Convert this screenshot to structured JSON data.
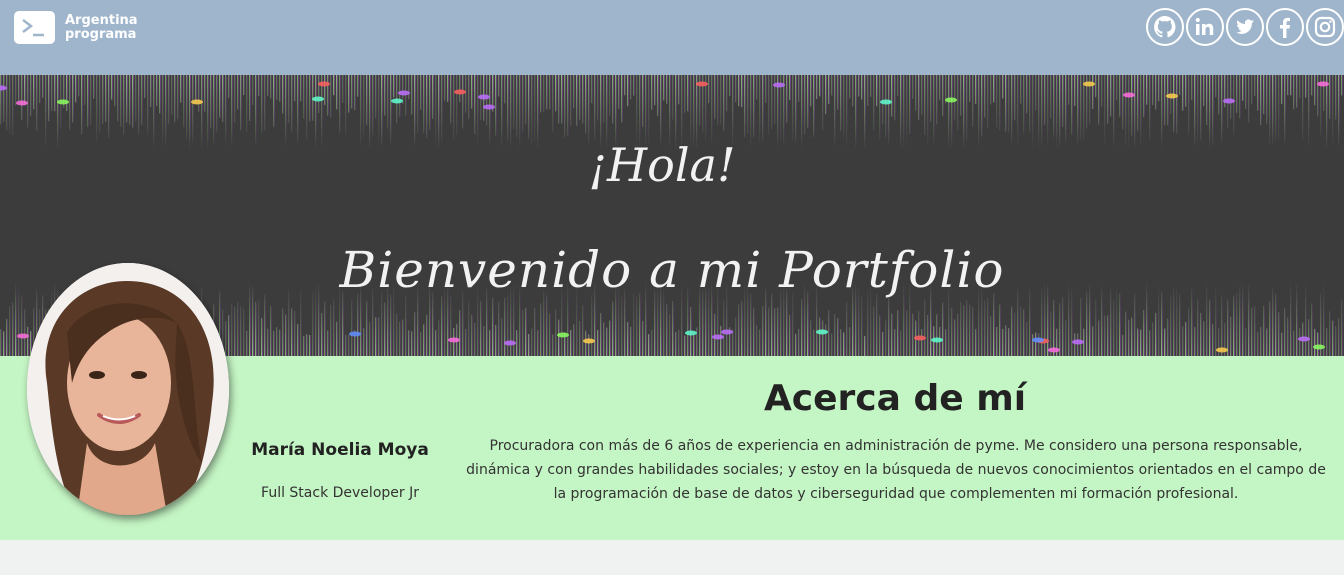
{
  "header": {
    "brand_line1": "Argentina",
    "brand_line2": "programa",
    "brand_icon": "terminal-icon",
    "socials": [
      {
        "name": "github",
        "icon": "github-icon"
      },
      {
        "name": "linkedin",
        "icon": "linkedin-icon",
        "label": "in"
      },
      {
        "name": "twitter",
        "icon": "twitter-icon"
      },
      {
        "name": "facebook",
        "icon": "facebook-icon",
        "label": "f"
      },
      {
        "name": "instagram",
        "icon": "instagram-icon"
      }
    ],
    "bg_color": "#9fb5cc"
  },
  "banner": {
    "greeting": "¡Hola!",
    "welcome": "Bienvenido a mi Portfolio"
  },
  "profile": {
    "name": "María Noelia Moya",
    "role": "Full Stack Developer Jr"
  },
  "about": {
    "title": "Acerca de mí",
    "text": "Procuradora con más de 6 años de experiencia en administración de pyme. Me considero una persona responsable, dinámica y con grandes habilidades sociales; y estoy en la búsqueda de nuevos conocimientos orientados en el campo de la programación de base de datos y ciberseguridad que complementen mi formación profesional.",
    "bg_color": "#c4f5c4"
  }
}
